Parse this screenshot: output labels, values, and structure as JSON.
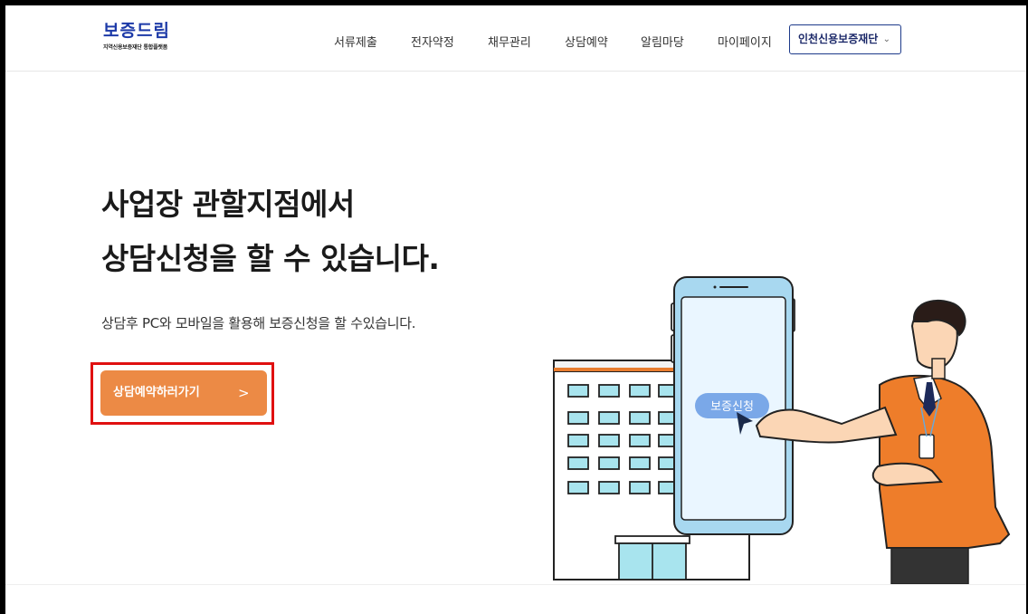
{
  "header": {
    "logo_title": "보증드림",
    "logo_subtitle": "지역신용보증재단 통합플랫폼",
    "nav": [
      "서류제출",
      "전자약정",
      "채무관리",
      "상담예약",
      "알림마당",
      "마이페이지"
    ],
    "org_select": "인천신용보증재단"
  },
  "main": {
    "heading_line1": "사업장 관할지점에서",
    "heading_line2": "상담신청을 할 수 있습니다.",
    "subtext": "상담후 PC와 모바일을 활용해 보증신청을 할 수있습니다.",
    "cta_label": "상담예약하러가기",
    "cta_arrow": ">",
    "bubble_label": "보증신청"
  },
  "colors": {
    "brand": "#1d3aa8",
    "cta": "#ec8a45",
    "highlight": "#e01010",
    "phone_screen": "#eaf6ff",
    "bubble": "#7aa8e8"
  }
}
